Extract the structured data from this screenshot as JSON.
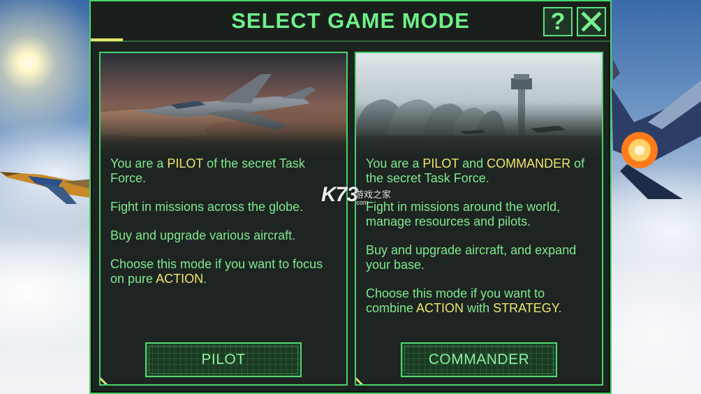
{
  "header": {
    "title": "SELECT GAME MODE",
    "help_label": "?",
    "close_icon": "close-x-icon"
  },
  "modes": [
    {
      "image": "fighter-jet-over-clouds",
      "paragraphs": [
        [
          "You are a ",
          "PILOT",
          " of the secret Task Force."
        ],
        [
          "Fight in missions across the globe."
        ],
        [
          "Buy and upgrade various aircraft."
        ],
        [
          "Choose this mode if you want to focus on pure ",
          "ACTION",
          "."
        ]
      ],
      "button_label": "PILOT"
    },
    {
      "image": "airbase-hangars-control-tower",
      "paragraphs": [
        [
          "You are a ",
          "PILOT",
          " and ",
          "COMMANDER",
          " of the secret Task Force."
        ],
        [
          "Fight in missions around the world, manage resources and pilots."
        ],
        [
          "Buy and upgrade aircraft, and expand your base."
        ],
        [
          "Choose this mode if you want to combine ",
          "ACTION",
          " with ",
          "STRATEGY",
          "."
        ]
      ],
      "button_label": "COMMANDER"
    }
  ],
  "watermark": {
    "logo": "K73",
    "site_cn": "游戏之家",
    "domain": ".com"
  },
  "colors": {
    "accent_green": "#6ff08a",
    "highlight_yellow": "#f2e66e",
    "panel_bg": "#1e2421",
    "border_green": "#46d66c"
  }
}
